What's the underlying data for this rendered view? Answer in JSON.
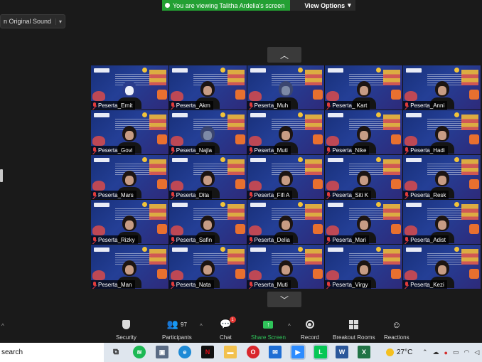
{
  "banner": {
    "viewing_text": "You are viewing Talitha Ardelia's screen",
    "view_options_label": "View Options",
    "view_options_caret": "▾"
  },
  "audio": {
    "label": "n Original Sound",
    "caret": "▾"
  },
  "gallery": {
    "scroll_up": "︿",
    "scroll_down": "﹀",
    "tiles": [
      {
        "name": "Peserta_Ernit"
      },
      {
        "name": "Peserta_Akm"
      },
      {
        "name": "Peserta_Muh"
      },
      {
        "name": "Peserta_ Kart"
      },
      {
        "name": "Peserta_Anni"
      },
      {
        "name": "Peserta_Govi"
      },
      {
        "name": "Peserta_Najla"
      },
      {
        "name": "Peserta_Muti"
      },
      {
        "name": "Peserta_Nike"
      },
      {
        "name": "Peserta_Hadi"
      },
      {
        "name": "Peserta_Mars"
      },
      {
        "name": "Peserta_Dita"
      },
      {
        "name": "Peserta_Fifi A"
      },
      {
        "name": "Peserta_Siti K"
      },
      {
        "name": "Peserta_Resk"
      },
      {
        "name": "Peserta_Rizky"
      },
      {
        "name": "Peserta_Safin"
      },
      {
        "name": "Peserta_Delia"
      },
      {
        "name": "Peserta_Mari"
      },
      {
        "name": "Peserta_Adist"
      },
      {
        "name": "Peserta_Man"
      },
      {
        "name": "Peserta_Nata"
      },
      {
        "name": "Peserta_Muti"
      },
      {
        "name": "Peserta_Virgy"
      },
      {
        "name": "Peserta_Kezi"
      }
    ]
  },
  "toolbar": {
    "security": "Security",
    "participants": "Participants",
    "participants_count": "97",
    "chat": "Chat",
    "chat_badge": "1",
    "share_screen": "Share Screen",
    "record": "Record",
    "breakout_rooms": "Breakout Rooms",
    "reactions": "Reactions",
    "caret": "^"
  },
  "taskbar": {
    "search_text": "search",
    "temperature": "27°C"
  }
}
